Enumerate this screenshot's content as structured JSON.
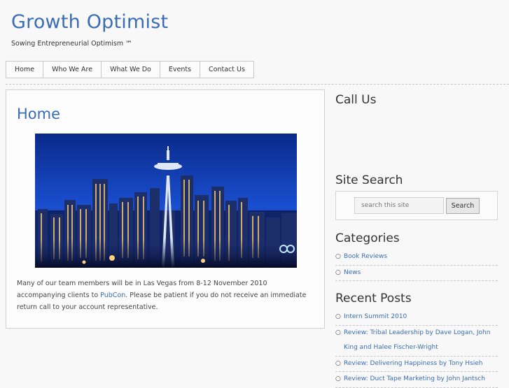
{
  "site": {
    "title": "Growth Optimist",
    "tagline": "Sowing Entrepreneurial Optimism ℠"
  },
  "nav": {
    "items": [
      {
        "label": "Home"
      },
      {
        "label": "Who We Are"
      },
      {
        "label": "What We Do"
      },
      {
        "label": "Events"
      },
      {
        "label": "Contact Us"
      }
    ]
  },
  "main": {
    "heading": "Home",
    "image_alt": "Seattle skyline at dusk with Space Needle",
    "text_before_link": "Many of our team members will be in Las Vegas from 8-12 November 2010 accompanying clients to ",
    "link_text": "PubCon",
    "text_after_link": ". Please be patient if you do not receive an immediate return call to your account representative."
  },
  "sidebar": {
    "call_us_heading": "Call Us",
    "site_search_heading": "Site Search",
    "search_placeholder": "search this site",
    "search_button": "Search",
    "categories_heading": "Categories",
    "categories": [
      "Book Reviews",
      "News"
    ],
    "recent_posts_heading": "Recent Posts",
    "recent_posts": [
      "Intern Summit 2010",
      "Review: Tribal Leadership by Dave Logan, John King and Halee Fischer-Wright",
      "Review: Delivering Happiness by Tony Hsieh",
      "Review: Duct Tape Marketing by John Jantsch"
    ]
  },
  "colors": {
    "link_blue": "#3a6db5",
    "background": "#f8f8f8",
    "border": "#c8c8c8"
  }
}
